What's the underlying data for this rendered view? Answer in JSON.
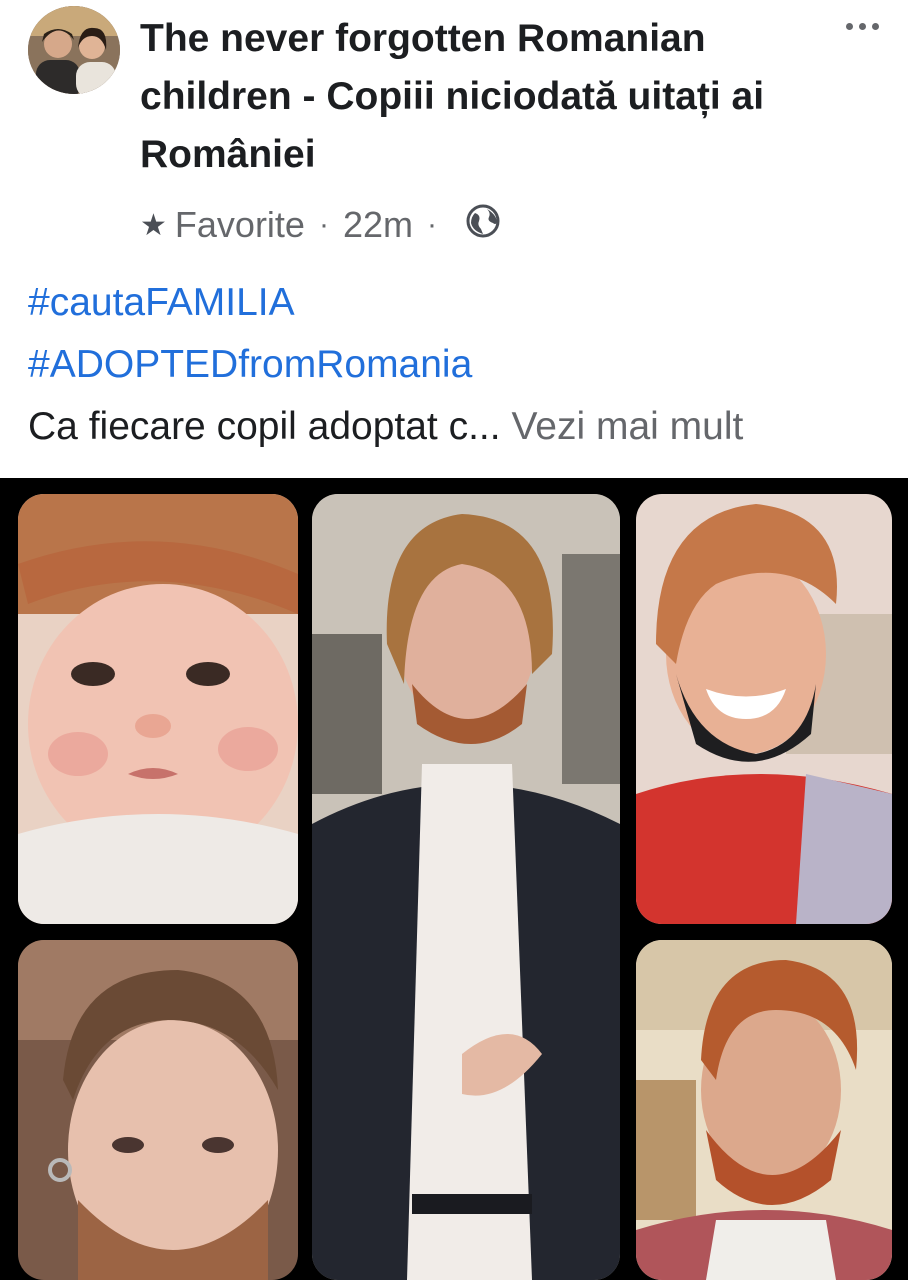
{
  "post": {
    "author": "The never forgotten Romanian children - Copiii niciodată uitați ai României",
    "favorite_label": "Favorite",
    "separator": "·",
    "time": "22m",
    "hashtags": [
      "#cautaFAMILIA",
      "#ADOPTEDfromRomania"
    ],
    "text": "Ca fiecare copil adoptat c...",
    "see_more": "Vezi mai mult"
  },
  "icons": {
    "more": "more-horizontal-icon",
    "favorite": "star-icon",
    "audience": "globe-icon"
  },
  "colors": {
    "link": "#216fdb",
    "secondary_text": "#65676b",
    "primary_text": "#1c1e21",
    "photo_background": "#000000"
  },
  "photo": {
    "tiles": [
      {
        "subject": "baby-portrait"
      },
      {
        "subject": "man-in-black-jacket"
      },
      {
        "subject": "smiling-man-red-shirt"
      },
      {
        "subject": "man-short-hair-earring"
      },
      {
        "subject": "man-with-beard-outdoors"
      }
    ]
  }
}
